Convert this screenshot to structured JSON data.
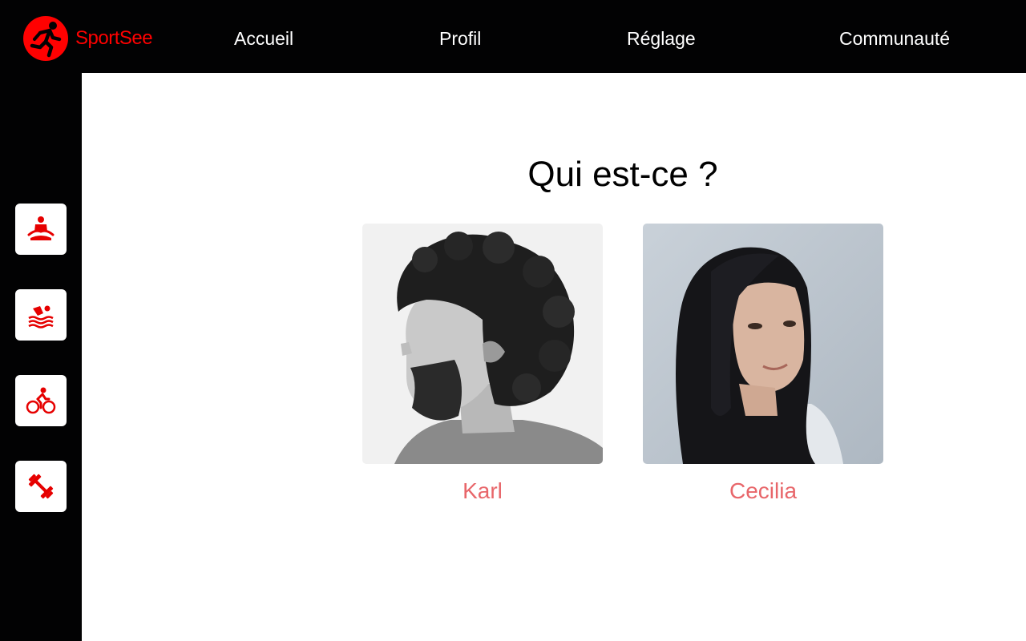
{
  "header": {
    "brand_name": "SportSee",
    "brand_color": "#ff0101",
    "logo_icon": "runner-logo-icon",
    "nav": [
      {
        "label": "Accueil"
      },
      {
        "label": "Profil"
      },
      {
        "label": "Réglage"
      },
      {
        "label": "Communauté"
      }
    ]
  },
  "sidebar": {
    "items": [
      {
        "icon": "yoga-meditation-icon"
      },
      {
        "icon": "swimming-icon"
      },
      {
        "icon": "cycling-icon"
      },
      {
        "icon": "dumbbell-icon"
      }
    ],
    "icon_color": "#e60000"
  },
  "main": {
    "title": "Qui est-ce ?",
    "users": [
      {
        "name": "Karl",
        "photo": "man-with-curly-hair-and-beard-profile-portrait"
      },
      {
        "name": "Cecilia",
        "photo": "young-woman-with-long-dark-hair-portrait"
      }
    ],
    "name_color": "#e8666a"
  }
}
